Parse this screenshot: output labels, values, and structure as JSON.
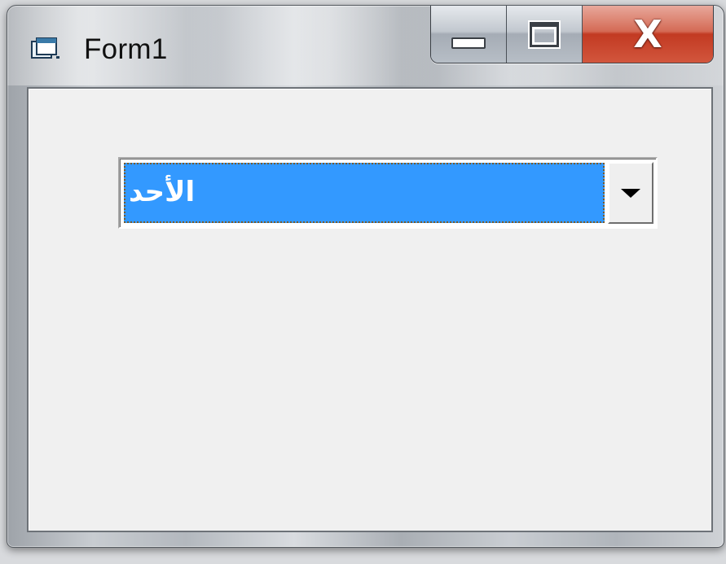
{
  "window": {
    "title": "Form1",
    "icon": "vb-form-icon",
    "buttons": {
      "minimize_icon": "minimize-icon",
      "maximize_icon": "maximize-icon",
      "close_glyph": "X"
    }
  },
  "combo": {
    "selected_value": "الأحد",
    "dropdown_icon": "chevron-down-icon",
    "highlight_color": "#3399ff"
  },
  "colors": {
    "client_background": "#f0f0f0",
    "close_button": "#c23a22"
  }
}
